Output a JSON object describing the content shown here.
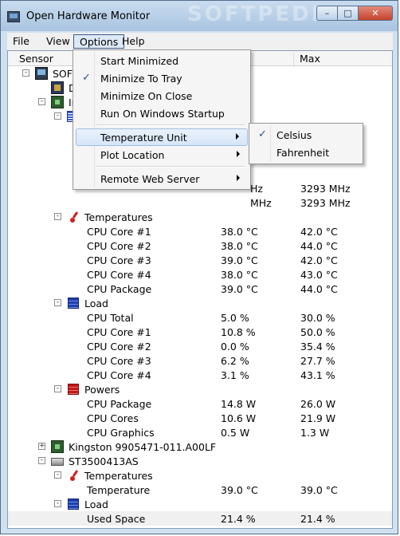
{
  "window": {
    "title": "Open Hardware Monitor",
    "watermark": "SOFTPEDIA"
  },
  "menubar": {
    "file": "File",
    "view": "View",
    "options": "Options",
    "help": "Help"
  },
  "columns": {
    "sensor": "Sensor",
    "value": "",
    "max": "Max"
  },
  "rows": [
    {
      "label": "SOFT",
      "value": "",
      "max": ""
    },
    {
      "label": "D",
      "value": "",
      "max": ""
    },
    {
      "label": "In",
      "value": "",
      "max": ""
    },
    {
      "label": "",
      "value": "",
      "max": ""
    },
    {
      "label": "",
      "value": "Hz",
      "max": "3293 MHz"
    },
    {
      "label": "",
      "value": "MHz",
      "max": "3293 MHz"
    },
    {
      "label": "Temperatures",
      "value": "",
      "max": ""
    },
    {
      "label": "CPU Core #1",
      "value": "38.0 °C",
      "max": "42.0 °C"
    },
    {
      "label": "CPU Core #2",
      "value": "38.0 °C",
      "max": "44.0 °C"
    },
    {
      "label": "CPU Core #3",
      "value": "39.0 °C",
      "max": "42.0 °C"
    },
    {
      "label": "CPU Core #4",
      "value": "38.0 °C",
      "max": "43.0 °C"
    },
    {
      "label": "CPU Package",
      "value": "39.0 °C",
      "max": "44.0 °C"
    },
    {
      "label": "Load",
      "value": "",
      "max": ""
    },
    {
      "label": "CPU Total",
      "value": "5.0 %",
      "max": "30.0 %"
    },
    {
      "label": "CPU Core #1",
      "value": "10.8 %",
      "max": "50.0 %"
    },
    {
      "label": "CPU Core #2",
      "value": "0.0 %",
      "max": "35.4 %"
    },
    {
      "label": "CPU Core #3",
      "value": "6.2 %",
      "max": "27.7 %"
    },
    {
      "label": "CPU Core #4",
      "value": "3.1 %",
      "max": "43.1 %"
    },
    {
      "label": "Powers",
      "value": "",
      "max": ""
    },
    {
      "label": "CPU Package",
      "value": "14.8 W",
      "max": "26.0 W"
    },
    {
      "label": "CPU Cores",
      "value": "10.6 W",
      "max": "21.9 W"
    },
    {
      "label": "CPU Graphics",
      "value": "0.5 W",
      "max": "1.3 W"
    },
    {
      "label": "Kingston 9905471-011.A00LF",
      "value": "",
      "max": ""
    },
    {
      "label": "ST3500413AS",
      "value": "",
      "max": ""
    },
    {
      "label": "Temperatures",
      "value": "",
      "max": ""
    },
    {
      "label": "Temperature",
      "value": "39.0 °C",
      "max": "39.0 °C"
    },
    {
      "label": "Load",
      "value": "",
      "max": ""
    },
    {
      "label": "Used Space",
      "value": "21.4 %",
      "max": "21.4 %"
    }
  ],
  "options_menu": {
    "start_minimized": "Start Minimized",
    "minimize_to_tray": "Minimize To Tray",
    "minimize_on_close": "Minimize On Close",
    "run_on_startup": "Run On Windows Startup",
    "temperature_unit": "Temperature Unit",
    "plot_location": "Plot Location",
    "remote_web_server": "Remote Web Server"
  },
  "temperature_submenu": {
    "celsius": "Celsius",
    "fahrenheit": "Fahrenheit"
  },
  "checkmark": "✓"
}
